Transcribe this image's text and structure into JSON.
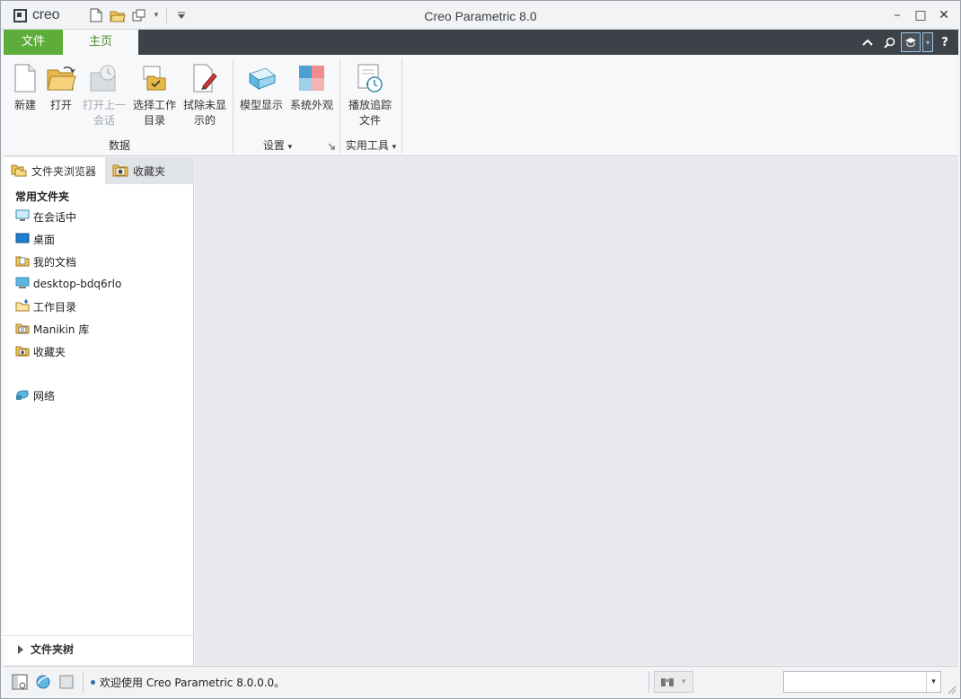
{
  "app": {
    "logo_text": "creo",
    "window_title": "Creo Parametric 8.0"
  },
  "window_controls": {
    "minimize": "–",
    "maximize": "□",
    "close": "✕"
  },
  "tabs": [
    {
      "label": "文件",
      "active": false
    },
    {
      "label": "主页",
      "active": true
    }
  ],
  "tab_right": {
    "collapse": "⌃",
    "search": "⌕",
    "help": "?"
  },
  "ribbon": {
    "groups": {
      "data": "数据",
      "settings": "设置",
      "utilities": "实用工具"
    },
    "buttons": {
      "new": {
        "line1": "新建",
        "line2": ""
      },
      "open": {
        "line1": "打开",
        "line2": ""
      },
      "open_last": {
        "line1": "打开上一",
        "line2": "会话"
      },
      "select_workdir": {
        "line1": "选择工作",
        "line2": "目录"
      },
      "erase_not_displayed": {
        "line1": "拭除未显",
        "line2": "示的"
      },
      "model_display": {
        "line1": "模型显示",
        "line2": ""
      },
      "system_appearance": {
        "line1": "系统外观",
        "line2": ""
      },
      "play_trail": {
        "line1": "播放追踪",
        "line2": "文件"
      }
    },
    "dropdown_arrow": "▾"
  },
  "panel": {
    "tabs": {
      "folder_browser": "文件夹浏览器",
      "favorites": "收藏夹"
    },
    "header": "常用文件夹",
    "items": [
      {
        "label": "在会话中",
        "icon": "session-icon"
      },
      {
        "label": "桌面",
        "icon": "desktop-icon"
      },
      {
        "label": "我的文档",
        "icon": "documents-icon"
      },
      {
        "label": "desktop-bdq6rlo",
        "icon": "computer-icon"
      },
      {
        "label": "工作目录",
        "icon": "workdir-icon"
      },
      {
        "label": "Manikin 库",
        "icon": "library-icon"
      },
      {
        "label": "收藏夹",
        "icon": "favorites-icon"
      },
      {
        "label": "网络",
        "icon": "network-icon"
      }
    ],
    "folder_tree": "文件夹树"
  },
  "status": {
    "message": "欢迎使用 Creo Parametric 8.0.0.0。",
    "selection_value": ""
  },
  "colors": {
    "file_tab": "#5eac3a",
    "home_tab_text": "#4b8d2b",
    "tabbar": "#3c4248",
    "main_bg": "#e8e9ec"
  }
}
